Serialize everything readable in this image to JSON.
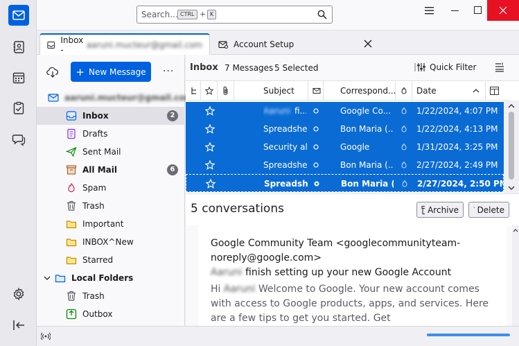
{
  "search": {
    "placeholder": "Search...",
    "key1": "CTRL",
    "plus": "+",
    "key2": "K"
  },
  "tabs": [
    {
      "label": "Inbox - ",
      "account": "aaruni.mucteur@gmail.com"
    },
    {
      "label": "Account Setup"
    }
  ],
  "folder_pane": {
    "new_message": "New Message",
    "account": "aaruni.mucteur@gmail.com",
    "folders": [
      {
        "label": "Inbox",
        "count": "2",
        "bold": true
      },
      {
        "label": "Drafts"
      },
      {
        "label": "Sent Mail"
      },
      {
        "label": "All Mail",
        "count": "6",
        "bold": true
      },
      {
        "label": "Spam"
      },
      {
        "label": "Trash"
      },
      {
        "label": "Important"
      },
      {
        "label": "INBOX^New"
      },
      {
        "label": "Starred"
      }
    ],
    "local": {
      "label": "Local Folders",
      "folders": [
        {
          "label": "Trash"
        },
        {
          "label": "Outbox"
        }
      ]
    }
  },
  "thread_pane": {
    "title": "Inbox",
    "message_count": "7 Messages",
    "selected_count": "5 Selected",
    "quick_filter": "Quick Filter",
    "columns": {
      "subject": "Subject",
      "correspondents": "Correspond...",
      "date": "Date"
    },
    "rows": [
      {
        "subject_blur": "Aaruni",
        "subject": "fi...",
        "from": "Google Co...",
        "date": "1/22/2024, 4:07 PM"
      },
      {
        "subject": "Spreadshe...",
        "from": "Bon Maria (...",
        "date": "1/22/2024, 4:13 PM"
      },
      {
        "subject": "Security al...",
        "from": "Google",
        "date": "1/31/2024, 3:25 PM"
      },
      {
        "subject": "Spreadshe...",
        "from": "Bon Maria (...",
        "date": "2/27/2024, 2:49 PM"
      },
      {
        "subject": "Spreadsh...",
        "from": "Bon Maria (...",
        "date": "2/27/2024, 2:50 PM"
      }
    ]
  },
  "message_pane": {
    "summary": "5 conversations",
    "archive": "Archive",
    "delete": "Delete",
    "sender": "Google Community Team <googlecommunityteam-noreply@google.com>",
    "subject_name": "Aaruni",
    "subject_rest": " finish setting up your new Google Account",
    "snippet_hi": "Hi ",
    "snippet_name": "Aaruni",
    "snippet_rest": " Welcome to Google. Your new account comes with access to Google products, apps, and services. Here are a few tips to get you started. Get"
  },
  "colors": {
    "accent": "#0061e0",
    "selection": "#0b6bd4",
    "close": "#e81123"
  }
}
